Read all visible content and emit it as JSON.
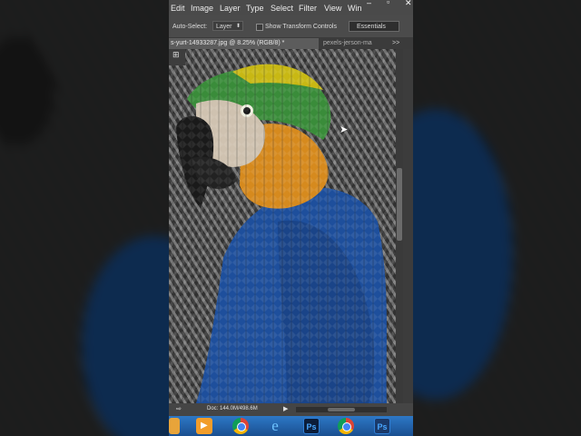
{
  "menu": {
    "items": [
      "Edit",
      "Image",
      "Layer",
      "Type",
      "Select",
      "Filter",
      "View",
      "Win"
    ]
  },
  "options_bar": {
    "auto_select_label": "Auto-Select:",
    "auto_select_value": "Layer",
    "show_transform_label": "Show Transform Controls",
    "workspace": "Essentials"
  },
  "tabs": {
    "active": "s-yurt-14933287.jpg @ 8.25% (RGB/8) *",
    "other": "pexels-jerson-ma",
    "more": ">>"
  },
  "status": {
    "doc": "Doc: 144.0M/498.6M"
  },
  "taskbar": {
    "ps1": "Ps",
    "ps2": "Ps"
  },
  "colors": {
    "ui_dark": "#535353",
    "taskbar": "#2d78c6",
    "ps_blue": "#48a6ff",
    "parrot_blue": "#1e4f9c",
    "parrot_gold": "#d68a1e",
    "parrot_green": "#3a8c3a"
  }
}
